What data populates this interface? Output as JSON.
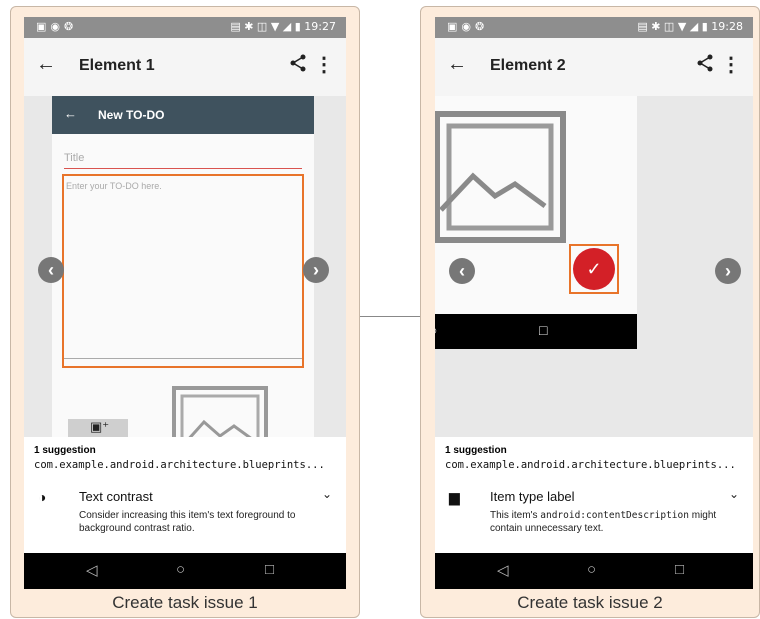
{
  "panels": [
    {
      "status": {
        "time": "19:27"
      },
      "appbar": {
        "title": "Element 1"
      },
      "inner": {
        "toolbar_title": "New TO-DO",
        "title_placeholder": "Title",
        "body_placeholder": "Enter your TO-DO here."
      },
      "suggestions": {
        "count": "1 suggestion",
        "package": "com.example.android.architecture.blueprints...",
        "issue_title": "Text contrast",
        "issue_desc": "Consider increasing this item's text foreground to background contrast ratio."
      },
      "caption": "Create task issue 1"
    },
    {
      "status": {
        "time": "19:28"
      },
      "appbar": {
        "title": "Element 2"
      },
      "suggestions": {
        "count": "1 suggestion",
        "package": "com.example.android.architecture.blueprints...",
        "issue_title_main": "Item type",
        "issue_title_rest": " label",
        "issue_desc_a": "This item's ",
        "issue_desc_code": "android:contentDescription",
        "issue_desc_b": " might contain unnecessary text."
      },
      "caption": "Create task issue 2"
    }
  ],
  "colors": {
    "highlight": "#e8742a",
    "fab": "#d32027",
    "inner_toolbar": "#3f525e",
    "panel_bg": "#fdecdc"
  },
  "icons": [
    "back-arrow-icon",
    "share-icon",
    "more-vert-icon",
    "contrast-icon",
    "comment-icon",
    "chevron-down-icon",
    "chevron-left-icon",
    "chevron-right-icon",
    "check-icon",
    "add-image-icon",
    "image-placeholder-icon",
    "nav-back-icon",
    "nav-home-icon",
    "nav-recents-icon"
  ]
}
